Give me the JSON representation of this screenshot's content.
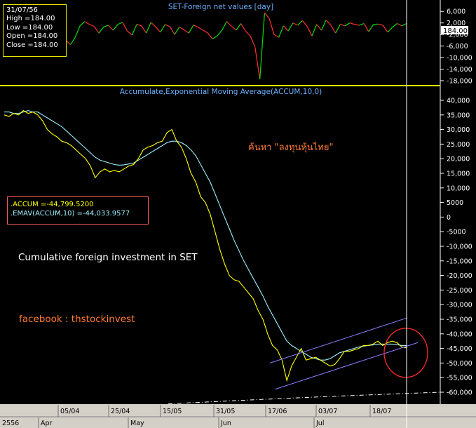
{
  "info_box": {
    "date": "31/07/56",
    "high": "High  =184.00",
    "low": "Low  =184.00",
    "open": "Open  =184.00",
    "close": "Close  =184.00"
  },
  "legend": {
    "accum": ".ACCUM   =-44,799.5200",
    "emav": ".EMAV(ACCUM,10)   =-44,033.9577"
  },
  "caption": "Cumulative foreign investment in SET",
  "facebook": "facebook : thstockinvest",
  "thai_note": "ค้นหา \"ลงทุนหุ้นไทย\"",
  "colors": {
    "up": "#00e000",
    "down": "#ff3030",
    "accum": "#ffff00",
    "emav": "#9ff0ff",
    "channel": "#8a7dff",
    "circle": "#ff2a2a",
    "divider": "#ffff00",
    "cursor": "#ffffff"
  },
  "chart_data": [
    {
      "type": "line",
      "title": "SET-Foreign net values [day]",
      "price_tag": "184.00",
      "y_ticks": [
        "6,000",
        "2,000",
        "-2,000",
        "-6,000",
        "-10,000",
        "-14,000",
        "-18,000"
      ],
      "ylim": [
        -18000,
        8000
      ],
      "series": [
        {
          "values": [
            1000,
            -1000,
            1500,
            -2000,
            800,
            1200,
            -500,
            2000,
            -1500,
            1000,
            500,
            -3000,
            -1200,
            -4000,
            -5500,
            -3000,
            1000,
            2500,
            1500,
            800,
            -1500,
            600,
            1200,
            -500,
            1500,
            2200,
            -800,
            -2200,
            1500,
            1000,
            -1500,
            2200,
            600,
            -1200,
            1500,
            700,
            -2000,
            600,
            -400,
            -1500,
            1300,
            500,
            -500,
            -1500,
            -3500,
            -2500,
            -500,
            2500,
            900,
            -500,
            1800,
            -900,
            -2500,
            -6500,
            -17500,
            5500,
            3500,
            -2000,
            -3000,
            1000,
            -800,
            2000,
            1200,
            2800,
            800,
            -2500,
            1500,
            -500,
            3000,
            1200,
            -1500,
            1500,
            1000,
            2000,
            1500,
            1200,
            1800,
            -1000,
            1500,
            1600,
            1200,
            -1200,
            500,
            1800,
            1000,
            1800
          ]
        }
      ]
    },
    {
      "type": "line",
      "title": "Accumulate,Exponential Moving Average(ACCUM,10,0)",
      "y_ticks": [
        "40,000",
        "35,000",
        "30,000",
        "25,000",
        "20,000",
        "15,000",
        "10,000",
        "5000",
        "0",
        "-5000",
        "-10,000",
        "-15,000",
        "-20,000",
        "-25,000",
        "-30,000",
        "-35,000",
        "-40,000",
        "-45,000",
        "-50,000",
        "-55,000",
        "-60,000"
      ],
      "ylim": [
        -60000,
        40000
      ],
      "x_ticks": [
        "05/04",
        "25/04",
        "15/05",
        "31/05",
        "17/06",
        "03/07",
        "18/07"
      ],
      "month_labels": [
        "2556",
        "Apr",
        "May",
        "Jun",
        "Jul"
      ],
      "series": [
        {
          "name": ".ACCUM",
          "values": [
            35000,
            34500,
            35500,
            35000,
            36500,
            35500,
            36000,
            35000,
            33000,
            30000,
            28500,
            27500,
            26000,
            25500,
            24500,
            23000,
            21500,
            20000,
            17500,
            13500,
            15500,
            16500,
            15500,
            16000,
            15500,
            16500,
            17500,
            18000,
            20000,
            23000,
            24000,
            24500,
            25500,
            26000,
            29000,
            30000,
            26000,
            24000,
            20000,
            15000,
            12000,
            7000,
            5000,
            1000,
            -5000,
            -11000,
            -16000,
            -20000,
            -21500,
            -22000,
            -24000,
            -26000,
            -28000,
            -32000,
            -35000,
            -40000,
            -44000,
            -45500,
            -49000,
            -56000,
            -51000,
            -48000,
            -45000,
            -49000,
            -48500,
            -48000,
            -49000,
            -50000,
            -51000,
            -50500,
            -48500,
            -46000,
            -46000,
            -45500,
            -45000,
            -44000,
            -44000,
            -43500,
            -42500,
            -44000,
            -43000,
            -42500,
            -43000,
            -44500,
            -44800
          ]
        },
        {
          "name": ".EMAV(ACCUM,10)",
          "values": [
            36000,
            36000,
            35500,
            35500,
            36000,
            36500,
            36000,
            36000,
            35000,
            34000,
            33000,
            32000,
            31000,
            29500,
            28000,
            26500,
            25000,
            23500,
            22000,
            20500,
            19500,
            19000,
            18500,
            18000,
            17800,
            17900,
            18200,
            18500,
            19500,
            20500,
            21500,
            22500,
            23500,
            24500,
            25500,
            26000,
            26000,
            25500,
            24500,
            23000,
            21000,
            18000,
            15000,
            12000,
            8000,
            4000,
            0,
            -4000,
            -8000,
            -11500,
            -15000,
            -18000,
            -21000,
            -24000,
            -27000,
            -30500,
            -33500,
            -36500,
            -39500,
            -42500,
            -44000,
            -45000,
            -46000,
            -47000,
            -48000,
            -48500,
            -49000,
            -49000,
            -48500,
            -47500,
            -46500,
            -46000,
            -45500,
            -45000,
            -44500,
            -44200,
            -44000,
            -43800,
            -43500,
            -43500,
            -43500,
            -43500,
            -43700,
            -44000,
            -44034
          ]
        }
      ]
    }
  ]
}
